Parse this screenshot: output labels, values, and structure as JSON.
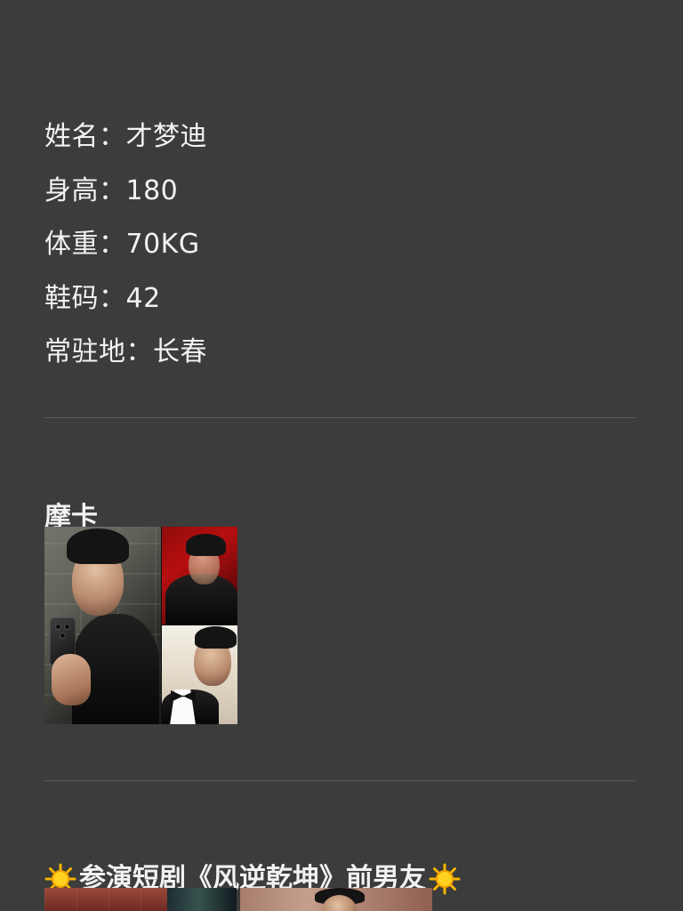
{
  "profile": {
    "fields": [
      {
        "label": "姓名：",
        "value": "才梦迪"
      },
      {
        "label": "身高：",
        "value": "180"
      },
      {
        "label": "体重：",
        "value": "70KG"
      },
      {
        "label": "鞋码：",
        "value": "42"
      },
      {
        "label": "常驻地：",
        "value": "长春"
      }
    ]
  },
  "sections": {
    "moka_title": "摩卡",
    "drama_title_text": "参演短剧《风逆乾坤》前男友",
    "drama_leading_icon": "sun-icon",
    "drama_trailing_icon": "sun-icon"
  },
  "colors": {
    "background": "#3c3c3c",
    "text": "#f2f2f2",
    "divider": "#5a5a5a"
  }
}
